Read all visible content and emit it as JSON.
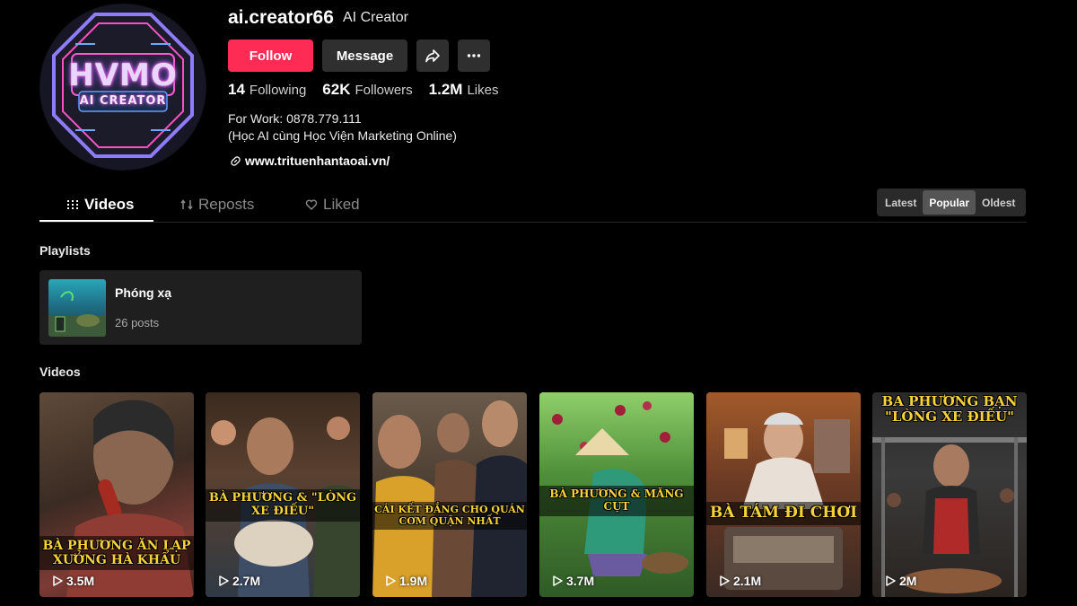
{
  "profile": {
    "avatar_line1": "HVMO",
    "avatar_line2": "AI CREATOR",
    "username": "ai.creator66",
    "display_name": "AI Creator",
    "follow_label": "Follow",
    "message_label": "Message",
    "stats": {
      "following_count": "14",
      "following_label": "Following",
      "followers_count": "62K",
      "followers_label": "Followers",
      "likes_count": "1.2M",
      "likes_label": "Likes"
    },
    "bio_line1": "For Work: 0878.779.111",
    "bio_line2": "(Học AI cùng Học Viện Marketing Online)",
    "link": "www.trituenhantaoai.vn/"
  },
  "tabs": [
    {
      "label": "Videos",
      "active": true,
      "icon": "grid-icon"
    },
    {
      "label": "Reposts",
      "active": false,
      "icon": "repost-icon"
    },
    {
      "label": "Liked",
      "active": false,
      "icon": "heart-icon"
    }
  ],
  "sort": {
    "options": [
      "Latest",
      "Popular",
      "Oldest"
    ],
    "selected": "Popular"
  },
  "playlists_title": "Playlists",
  "playlist": {
    "name": "Phóng xạ",
    "count": "26 posts"
  },
  "videos_title": "Videos",
  "videos": [
    {
      "caption": "BÀ PHƯƠNG ĂN LẠP XƯỞNG HÀ KHẨU",
      "views": "3.5M"
    },
    {
      "caption": "BÀ PHƯƠNG & \"LÒNG XE ĐIẾU\"",
      "views": "2.7M"
    },
    {
      "caption": "CÁI KẾT ĐẮNG CHO QUÁN CƠM QUẬN NHẤT",
      "views": "1.9M"
    },
    {
      "caption": "BÀ PHƯƠNG & MĂNG CỤT",
      "views": "3.7M"
    },
    {
      "caption": "BÀ TÁM ĐI CHƠI",
      "views": "2.1M"
    },
    {
      "caption": "BA PHƯƠNG BẠN \"LÒNG XE ĐIẾU\"",
      "views": "2M"
    }
  ],
  "colors": {
    "accent": "#fe2c55",
    "caption": "#f7d23a",
    "surface": "#1f1f1f"
  }
}
